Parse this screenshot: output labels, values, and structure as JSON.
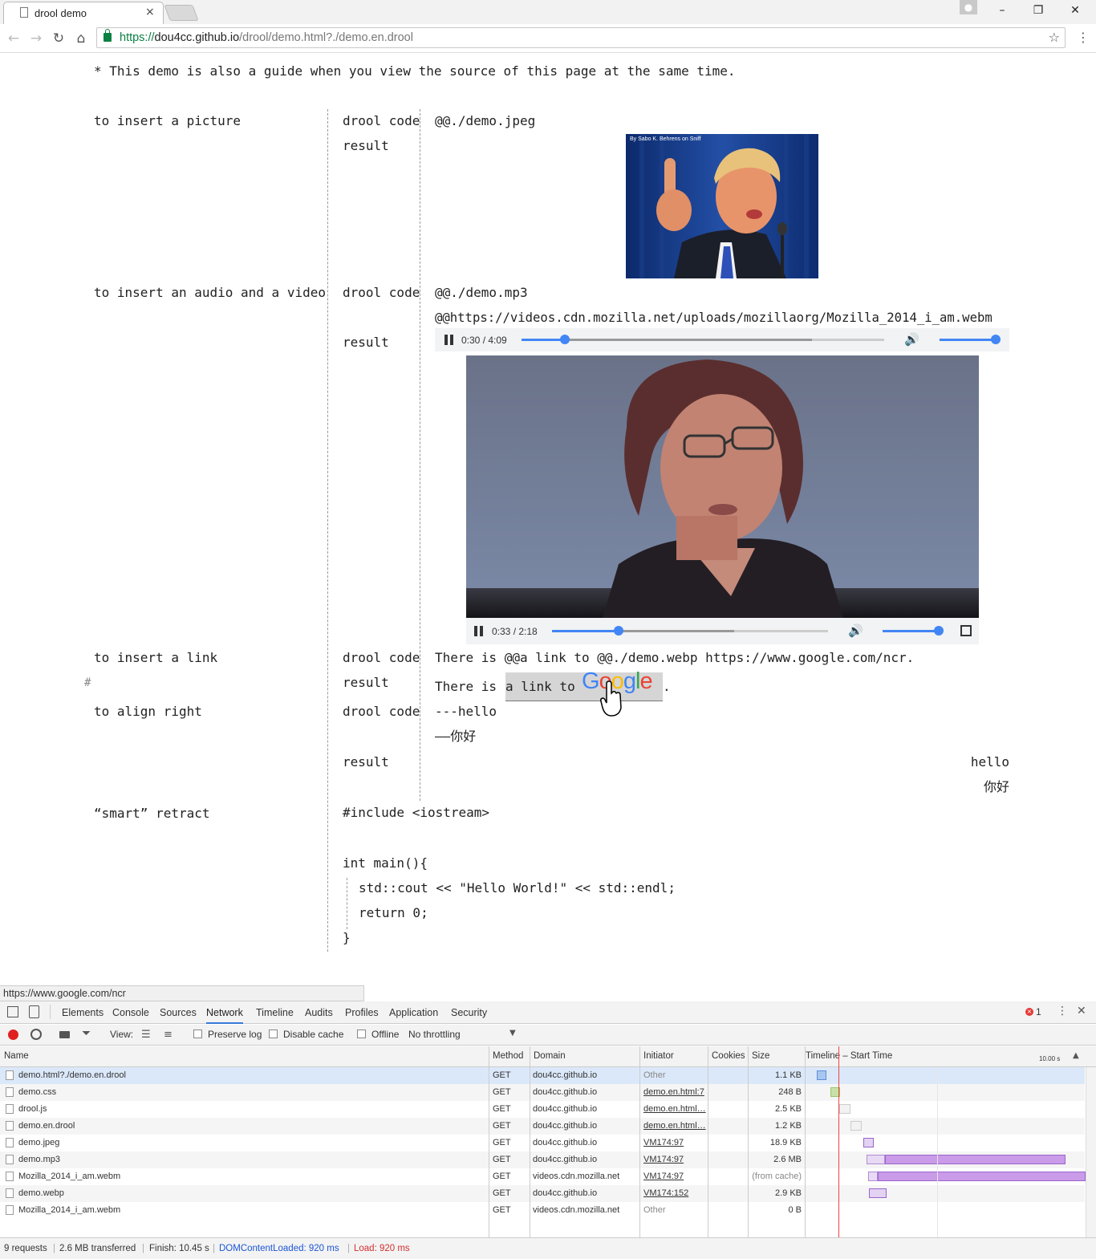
{
  "browser": {
    "tab_title": "drool demo",
    "tab_close": "×",
    "url_scheme": "https://",
    "url_host": "dou4cc.github.io",
    "url_path": "/drool/demo.html?./demo.en.drool",
    "window_controls": [
      "–",
      "❐",
      "✕"
    ]
  },
  "page": {
    "intro": "* This demo is also a guide when you view the source of this page at the same time.",
    "sections": {
      "picture": {
        "title": "to insert a picture",
        "code_label": "drool code",
        "code": "@@./demo.jpeg",
        "result_label": "result",
        "image_caption": "By Sabo K. Behrens on Sniff"
      },
      "media": {
        "title": "to insert an audio and a video",
        "code_label": "drool code",
        "code_line1": "@@./demo.mp3",
        "code_line2": "@@https://videos.cdn.mozilla.net/uploads/mozillaorg/Mozilla_2014_i_am.webm",
        "result_label": "result"
      },
      "link": {
        "title": "to insert a link",
        "code_label": "drool code",
        "code": "There is @@a link to @@./demo.webp https://www.google.com/ncr.",
        "hash": "#",
        "result_label": "result",
        "result_prefix": "There is ",
        "link_text": "a link to ",
        "result_suffix": "."
      },
      "align": {
        "title": "to align right",
        "code_label": "drool code",
        "code_line1": "---hello",
        "code_line2": "——你好",
        "result_label": "result",
        "result_line1": "hello",
        "result_line2": "你好"
      },
      "retract": {
        "title": "“smart” retract",
        "line1": "#include <iostream>",
        "line2": "int main(){",
        "line3": "std::cout << \"Hello World!\" << std::endl;",
        "line4": "return 0;",
        "line5": "}"
      }
    },
    "audio": {
      "time": "0:30 / 4:09",
      "progress": 0.12,
      "buffered": 0.8,
      "volume": 1.0
    },
    "video": {
      "time": "0:33 / 2:18",
      "progress": 0.24,
      "buffered": 0.66,
      "volume": 1.0
    },
    "google_letters": [
      "G",
      "o",
      "o",
      "g",
      "l",
      "e"
    ],
    "google_colors": [
      "#4285f4",
      "#ea4335",
      "#fbbc05",
      "#4285f4",
      "#34a853",
      "#ea4335"
    ]
  },
  "status_bar": "https://www.google.com/ncr",
  "devtools": {
    "tabs": [
      "Elements",
      "Console",
      "Sources",
      "Network",
      "Timeline",
      "Audits",
      "Profiles",
      "Application",
      "Security"
    ],
    "active_tab": "Network",
    "error_count": "1",
    "toolbar": {
      "view": "View:",
      "preserve_log": "Preserve log",
      "disable_cache": "Disable cache",
      "offline": "Offline",
      "throttling": "No throttling"
    },
    "columns": [
      "Name",
      "Method",
      "Domain",
      "Initiator",
      "Cookies",
      "Size",
      "Timeline – Start Time"
    ],
    "timeline_scale": "10.00 s",
    "rows": [
      {
        "name": "demo.html?./demo.en.drool",
        "method": "GET",
        "domain": "dou4cc.github.io",
        "initiator": "Other",
        "initiator_link": false,
        "size": "1.1 KB"
      },
      {
        "name": "demo.css",
        "method": "GET",
        "domain": "dou4cc.github.io",
        "initiator": "demo.en.html:7",
        "initiator_link": true,
        "size": "248 B"
      },
      {
        "name": "drool.js",
        "method": "GET",
        "domain": "dou4cc.github.io",
        "initiator": "demo.en.html…",
        "initiator_link": true,
        "size": "2.5 KB"
      },
      {
        "name": "demo.en.drool",
        "method": "GET",
        "domain": "dou4cc.github.io",
        "initiator": "demo.en.html…",
        "initiator_link": true,
        "size": "1.2 KB"
      },
      {
        "name": "demo.jpeg",
        "method": "GET",
        "domain": "dou4cc.github.io",
        "initiator": "VM174:97",
        "initiator_link": true,
        "size": "18.9 KB"
      },
      {
        "name": "demo.mp3",
        "method": "GET",
        "domain": "dou4cc.github.io",
        "initiator": "VM174:97",
        "initiator_link": true,
        "size": "2.6 MB"
      },
      {
        "name": "Mozilla_2014_i_am.webm",
        "method": "GET",
        "domain": "videos.cdn.mozilla.net",
        "initiator": "VM174:97",
        "initiator_link": true,
        "size": "(from cache)"
      },
      {
        "name": "demo.webp",
        "method": "GET",
        "domain": "dou4cc.github.io",
        "initiator": "VM174:152",
        "initiator_link": true,
        "size": "2.9 KB"
      },
      {
        "name": "Mozilla_2014_i_am.webm",
        "method": "GET",
        "domain": "videos.cdn.mozilla.net",
        "initiator": "Other",
        "initiator_link": false,
        "size": "0 B"
      }
    ],
    "summary": {
      "requests": "9 requests",
      "transferred": "2.6 MB transferred",
      "finish": "Finish: 10.45 s",
      "dom": "DOMContentLoaded: 920 ms",
      "load": "Load: 920 ms"
    }
  }
}
